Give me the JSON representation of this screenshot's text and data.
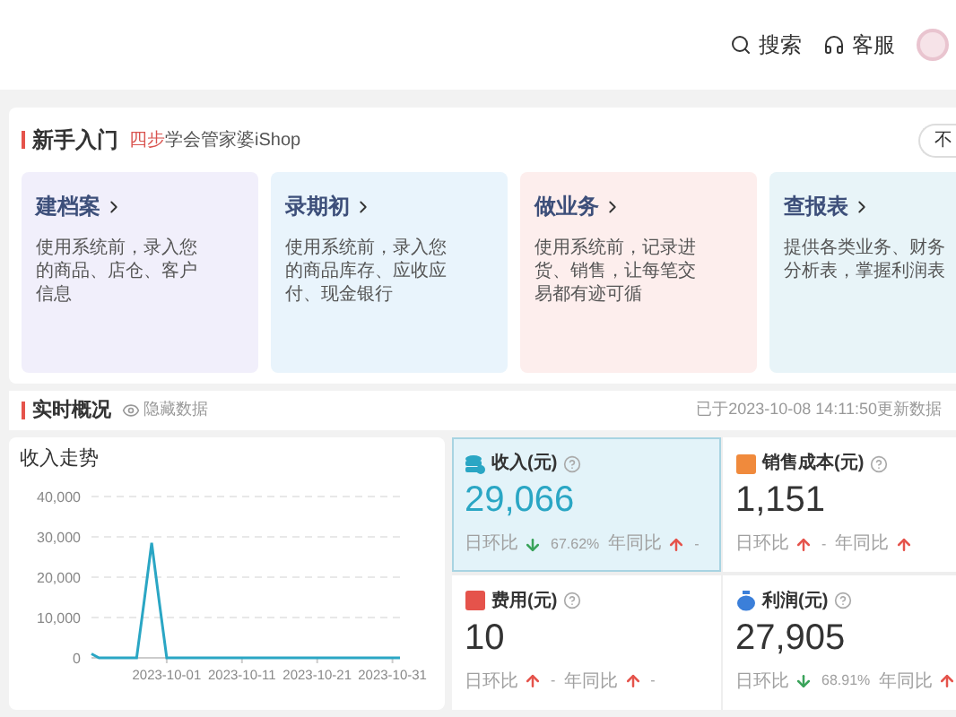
{
  "header": {
    "actions": [
      {
        "kind": "search",
        "label": "搜索"
      },
      {
        "kind": "service",
        "label": "客服"
      }
    ]
  },
  "guide": {
    "title": "新手入门",
    "subtitle_highlight": "四步",
    "subtitle": "学会管家婆iShop",
    "button": "不",
    "cards": [
      {
        "title": "建档案",
        "lines": [
          "使用系统前，录入您",
          "的商品、店仓、客户",
          "信息"
        ],
        "color": "#f1effb"
      },
      {
        "title": "录期初",
        "lines": [
          "使用系统前，录入您",
          "的商品库存、应收应",
          "付、现金银行"
        ],
        "color": "#e9f4fc"
      },
      {
        "title": "做业务",
        "lines": [
          "使用系统前，记录进",
          "货、销售，让每笔交",
          "易都有迹可循"
        ],
        "color": "#fdeeed"
      },
      {
        "title": "查报表",
        "lines": [
          "提供各类业务、财务",
          "分析表，掌握利润表"
        ],
        "color": "#e8f4f8"
      }
    ]
  },
  "overview": {
    "title": "实时概况",
    "toggle": "隐藏数据",
    "updated": "已于2023-10-08 14:11:50更新数据"
  },
  "trend": {
    "title": "收入走势",
    "chart_data": {
      "type": "line",
      "grid": true,
      "categories": [
        null,
        null,
        null,
        null,
        null,
        null,
        null,
        null,
        null,
        null,
        "2023-10-01",
        null,
        null,
        null,
        null,
        null,
        null,
        null,
        null,
        null,
        "2023-10-11",
        null,
        null,
        null,
        null,
        null,
        null,
        null,
        null,
        null,
        "2023-10-21",
        null,
        null,
        null,
        null,
        null,
        null,
        null,
        null,
        null,
        "2023-10-31",
        null
      ],
      "series": [
        {
          "color": "#2aa6c4",
          "values": [
            1000,
            0,
            0,
            0,
            0,
            0,
            0,
            14000,
            28500,
            14000,
            0,
            0,
            0,
            0,
            0,
            0,
            0,
            0,
            0,
            0,
            0,
            0,
            0,
            0,
            0,
            0,
            0,
            0,
            0,
            0,
            0,
            0,
            0,
            0,
            0,
            0,
            0,
            0,
            0,
            0,
            0,
            0
          ]
        }
      ],
      "ylim": [
        0,
        40000
      ],
      "yticks": [
        {
          "value": 0,
          "label": "0"
        },
        {
          "value": 10000,
          "label": "10,000"
        },
        {
          "value": 20000,
          "label": "20,000"
        },
        {
          "value": 30000,
          "label": "30,000"
        },
        {
          "value": 40000,
          "label": "40,000"
        }
      ]
    }
  },
  "kpis": [
    {
      "kind": "income",
      "title": "收入(元)",
      "value": "29,066",
      "selected": true,
      "day": {
        "label": "日环比",
        "increase": false,
        "change": "67.62%"
      },
      "year": {
        "label": "年同比",
        "increase": true,
        "change": "-"
      }
    },
    {
      "kind": "cost",
      "title": "销售成本(元)",
      "value": "1,151",
      "selected": false,
      "day": {
        "label": "日环比",
        "increase": true,
        "change": "-"
      },
      "year": {
        "label": "年同比",
        "increase": true
      }
    },
    {
      "kind": "expense",
      "title": "费用(元)",
      "value": "10",
      "selected": false,
      "day": {
        "label": "日环比",
        "increase": true,
        "change": "-"
      },
      "year": {
        "label": "年同比",
        "increase": true,
        "change": "-"
      }
    },
    {
      "kind": "profit",
      "title": "利润(元)",
      "value": "27,905",
      "selected": false,
      "day": {
        "label": "日环比",
        "increase": false,
        "change": "68.91%"
      },
      "year": {
        "label": "年同比",
        "increase": true
      }
    }
  ]
}
